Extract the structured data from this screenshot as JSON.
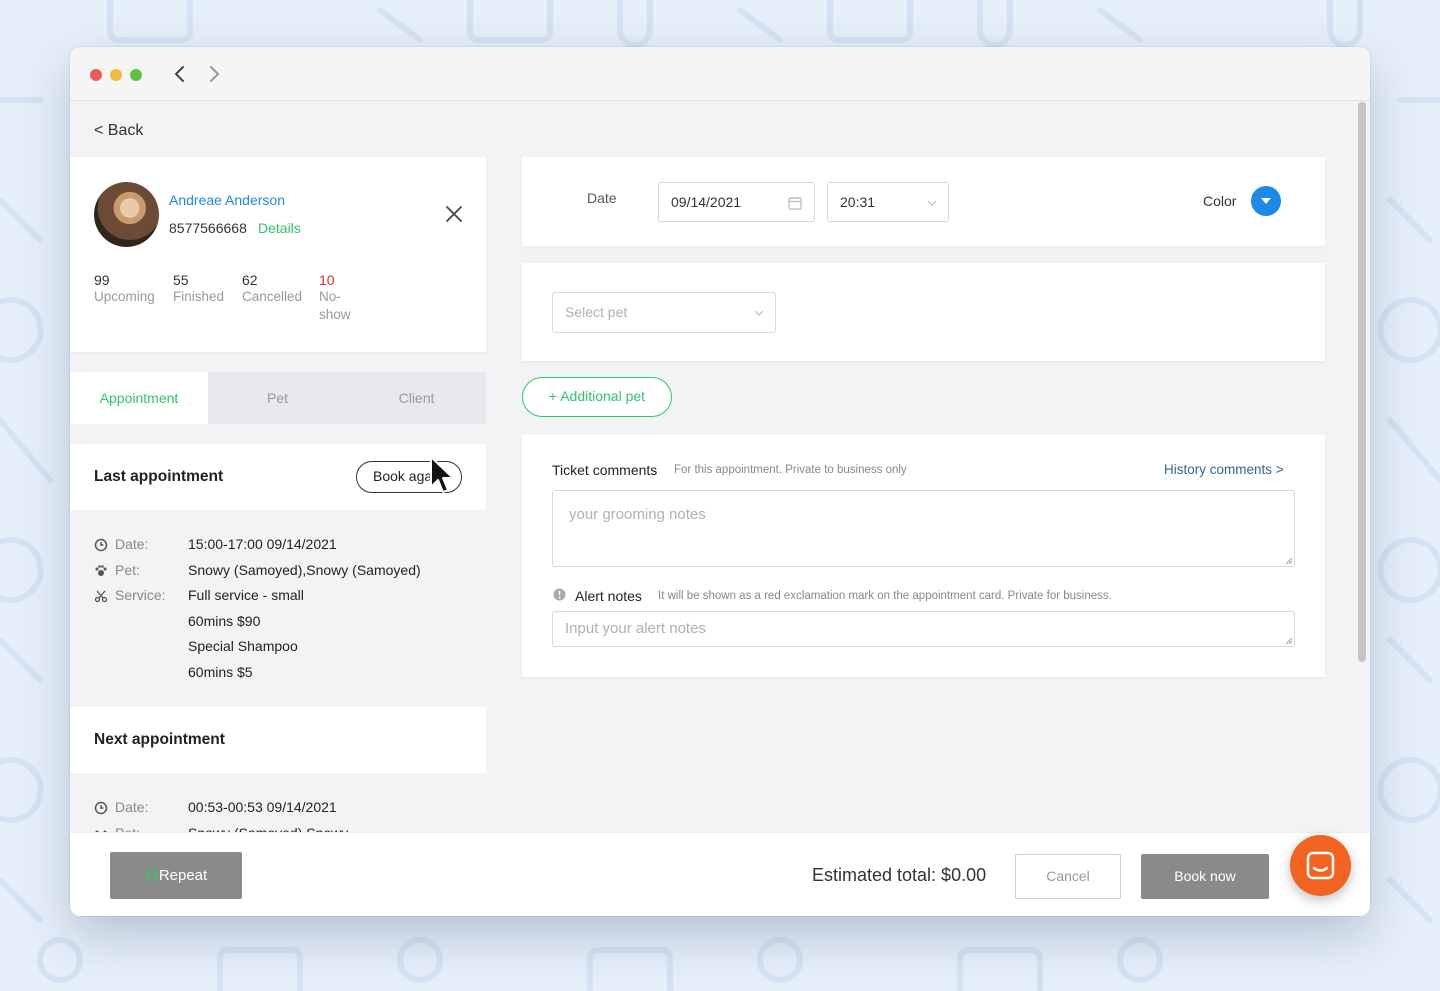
{
  "nav": {
    "back_label": "< Back"
  },
  "client": {
    "name": "Andreae Anderson",
    "phone": "8577566668",
    "details_link": "Details",
    "stats": [
      {
        "num": "99",
        "label": "Upcoming"
      },
      {
        "num": "55",
        "label": "Finished"
      },
      {
        "num": "62",
        "label": "Cancelled"
      },
      {
        "num": "10",
        "label": "No-show"
      }
    ]
  },
  "tabs": [
    "Appointment",
    "Pet",
    "Client"
  ],
  "last_appointment": {
    "title": "Last appointment",
    "book_again": "Book again",
    "date_label": "Date:",
    "date_value": "15:00-17:00 09/14/2021",
    "pet_label": "Pet:",
    "pet_value": "Snowy (Samoyed),Snowy (Samoyed)",
    "service_label": "Service:",
    "service_lines": [
      "Full service - small",
      "60mins  $90",
      "Special Shampoo",
      "60mins  $5"
    ]
  },
  "next_appointment": {
    "title": "Next appointment",
    "date_label": "Date:",
    "date_value": "00:53-00:53 09/14/2021",
    "pet_label": "Pet:",
    "pet_value": "Snowy (Samoyed),Snowy"
  },
  "form": {
    "date_label": "Date",
    "date_value": "09/14/2021",
    "time_value": "20:31",
    "color_label": "Color",
    "color_value": "#1e88e5",
    "select_pet_placeholder": "Select pet",
    "additional_pet": "+ Additional pet",
    "ticket_comments_title": "Ticket comments",
    "ticket_comments_sub": "For this appointment. Private to business only",
    "history_comments": "History comments >",
    "grooming_placeholder": "your grooming notes",
    "alert_title": "Alert notes",
    "alert_sub": "It will be shown as a red exclamation mark on the appointment card. Private for business.",
    "alert_placeholder": "Input your alert notes"
  },
  "footer": {
    "repeat": "Repeat",
    "estimated_total": "Estimated total: $0.00",
    "cancel": "Cancel",
    "book_now": "Book now"
  },
  "colors": {
    "accent_green": "#2ec66a",
    "link_blue": "#1e88e5",
    "noshow_red": "#d0312d",
    "chat_orange": "#f26322"
  }
}
